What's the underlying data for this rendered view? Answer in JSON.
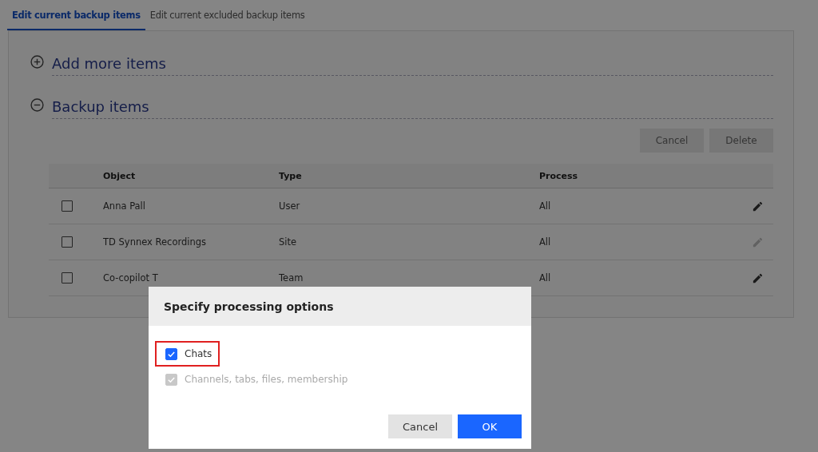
{
  "tabs": [
    {
      "label": "Edit current backup items",
      "selected": true
    },
    {
      "label": "Edit current excluded backup items",
      "selected": false
    }
  ],
  "sections": [
    {
      "title": "Add more items",
      "expanded": false
    },
    {
      "title": "Backup items",
      "expanded": true
    }
  ],
  "actions": [
    {
      "label": "Cancel",
      "disabled": true
    },
    {
      "label": "Delete",
      "disabled": true
    }
  ],
  "table": {
    "columns": [
      "Object",
      "Type",
      "Process"
    ],
    "rows": [
      {
        "checked": false,
        "object": "Anna Pall",
        "type": "User",
        "process": "All",
        "edit_disabled": false
      },
      {
        "checked": false,
        "object": "TD Synnex Recordings",
        "type": "Site",
        "process": "All",
        "edit_disabled": true
      },
      {
        "checked": false,
        "object": "Co-copilot T",
        "type": "Team",
        "process": "All",
        "edit_disabled": false
      }
    ]
  },
  "dialog": {
    "title": "Specify processing options",
    "options": [
      {
        "label": "Chats",
        "checked": true,
        "disabled": false,
        "highlighted": true
      },
      {
        "label": "Channels, tabs, files, membership",
        "checked": true,
        "disabled": true,
        "highlighted": false
      }
    ],
    "buttons": [
      {
        "label": "Cancel",
        "kind": "secondary"
      },
      {
        "label": "OK",
        "kind": "primary"
      }
    ]
  }
}
